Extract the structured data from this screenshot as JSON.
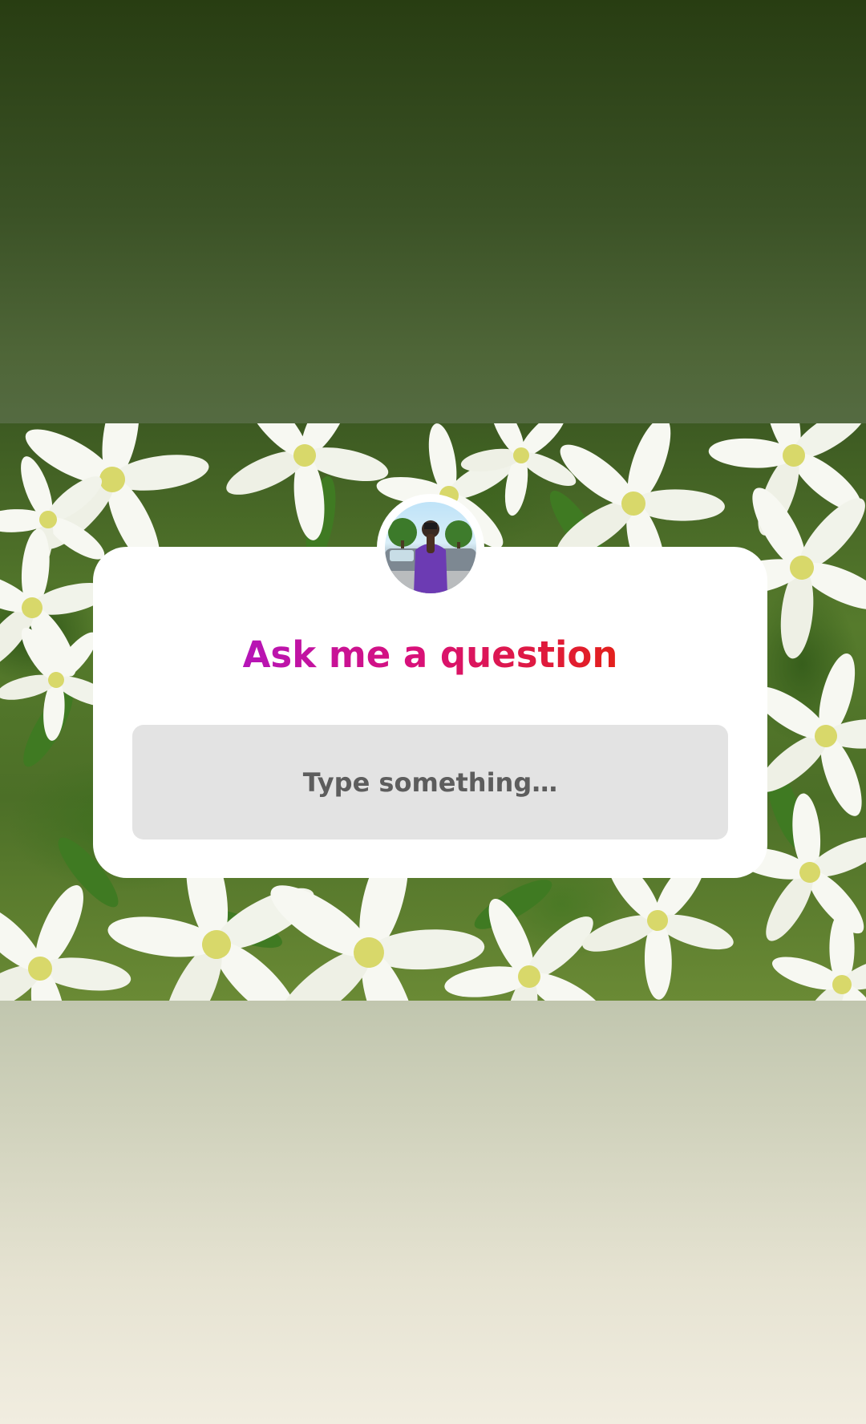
{
  "story": {
    "background_colors": [
      "#283d12",
      "#556b42",
      "#b5bda4",
      "#f1ede0"
    ]
  },
  "photo": {
    "subject": "white flowers"
  },
  "question_sticker": {
    "avatar_icon": "profile-avatar",
    "title": "Ask me a question",
    "title_gradient": [
      "#b515b8",
      "#d8107a",
      "#e3201b"
    ],
    "input": {
      "placeholder": "Type something…",
      "value": ""
    }
  }
}
